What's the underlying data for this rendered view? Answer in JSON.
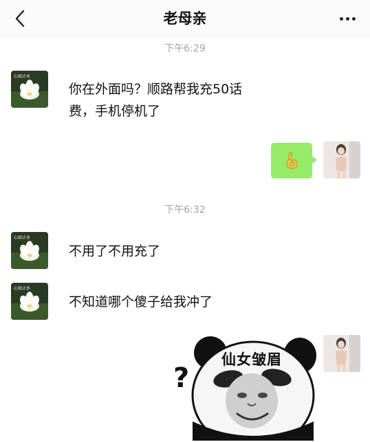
{
  "header": {
    "title": "老母亲",
    "back_icon": "chevron-left-icon",
    "more_icon": "more-dots-icon"
  },
  "timestamps": [
    "下午6:29",
    "下午6:32"
  ],
  "messages": [
    {
      "sender": "left",
      "text_line1": "你在外面吗？顺路帮我充50话",
      "text_line2": "费，手机停机了"
    },
    {
      "sender": "right",
      "type": "emoji",
      "icon": "ok-hand-emoji-icon"
    },
    {
      "sender": "left",
      "text": "不用了不用充了"
    },
    {
      "sender": "left",
      "text": "不知道哪个傻子给我冲了"
    },
    {
      "sender": "right",
      "type": "sticker",
      "caption": "仙女皱眉",
      "mark": "?"
    }
  ],
  "avatars": {
    "mother_label": "心如止水",
    "bubble_color": "#95ec69"
  }
}
